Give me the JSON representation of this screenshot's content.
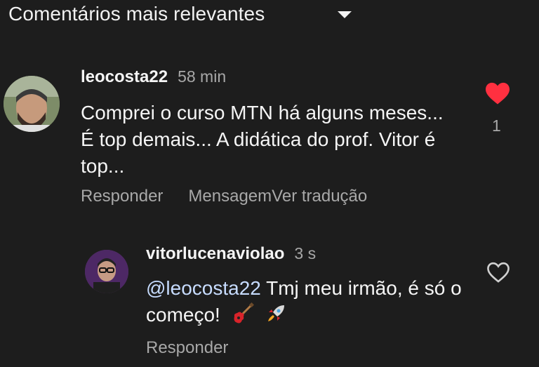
{
  "header": {
    "title": "Comentários mais relevantes",
    "chevron_icon": "chevron-down-icon"
  },
  "comments": [
    {
      "username": "leocosta22",
      "time": "58 min",
      "text": "Comprei o curso MTN há alguns meses... É top demais... A didática do prof. Vitor é top...",
      "actions": {
        "reply": "Responder",
        "message": "Mensagem",
        "translate": "Ver tradução"
      },
      "like": {
        "icon": "heart-filled-icon",
        "liked": true,
        "count": "1",
        "color": "#ff3040"
      }
    },
    {
      "username": "vitorlucenaviolao",
      "time": "3 s",
      "mention": "@leocosta22",
      "text": " Tmj meu irmão, é só o começo!",
      "emojis": [
        "guitar-emoji",
        "rocket-emoji"
      ],
      "actions": {
        "reply": "Responder"
      },
      "like": {
        "icon": "heart-outline-icon",
        "liked": false
      }
    }
  ],
  "colors": {
    "background": "#1d1d1d",
    "primary_text": "#f5f5f5",
    "secondary_text": "#a8a8a8",
    "mention": "#c7dcff",
    "like_red": "#ff3040"
  }
}
